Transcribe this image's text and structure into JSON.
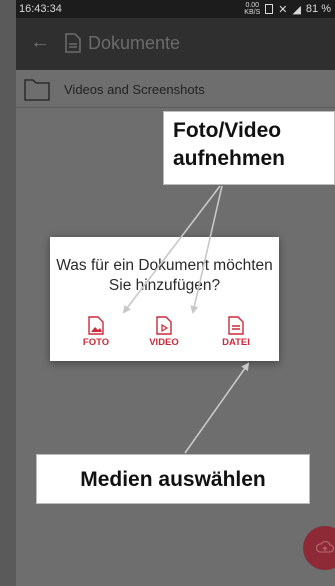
{
  "statusbar": {
    "time": "16:43:34",
    "speed_value": "0.00",
    "speed_unit": "KB/S",
    "battery": "81 %"
  },
  "appbar": {
    "title": "Dokumente"
  },
  "folder": {
    "label": "Videos and Screenshots"
  },
  "dialog": {
    "question": "Was für ein Dokument möchten Sie hinzufügen?",
    "options": [
      {
        "label": "FOTO",
        "icon": "image-file-icon"
      },
      {
        "label": "VIDEO",
        "icon": "video-file-icon"
      },
      {
        "label": "DATEI",
        "icon": "document-file-icon"
      }
    ]
  },
  "annotations": {
    "top_callout_line1": "Foto/Video",
    "top_callout_line2": "aufnehmen",
    "bottom_callout": "Medien auswählen"
  },
  "colors": {
    "accent": "#cc2a3a",
    "fab": "#8d2a35",
    "appbar": "#2f2f2f"
  }
}
